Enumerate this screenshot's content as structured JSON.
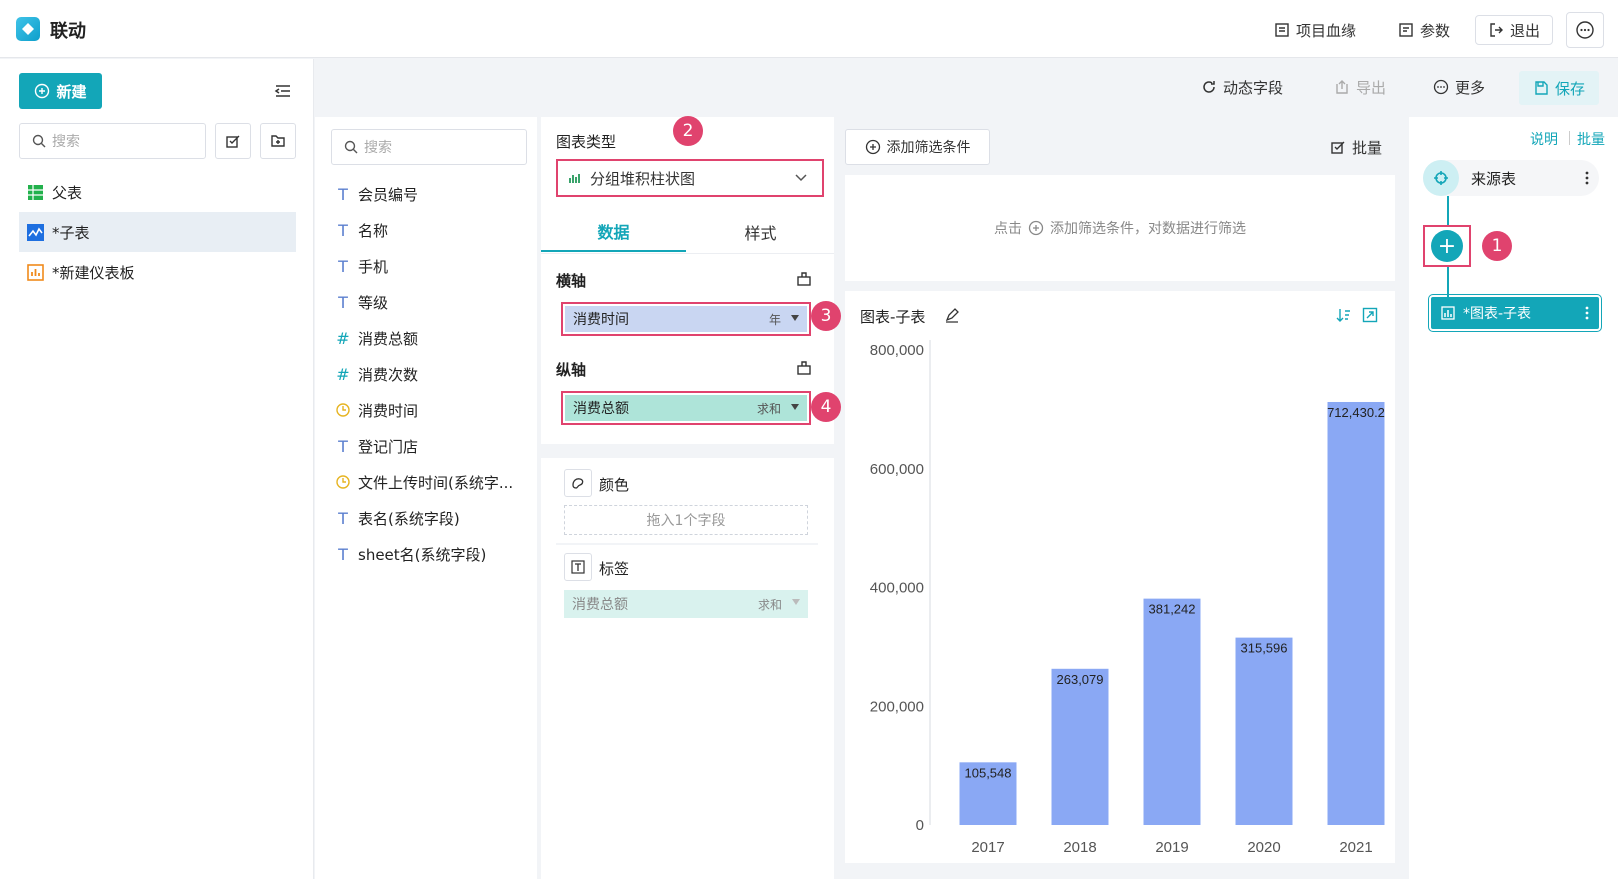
{
  "app": {
    "title": "联动"
  },
  "topbar": {
    "lineage": "项目血缘",
    "params": "参数",
    "exit": "退出"
  },
  "toolbar": {
    "dynamic_field": "动态字段",
    "export": "导出",
    "more": "更多",
    "save": "保存"
  },
  "sidebar": {
    "new_label": "新建",
    "search_placeholder": "搜索",
    "items": [
      {
        "label": "父表",
        "icon": "table-icon"
      },
      {
        "label": "*子表",
        "icon": "line-chart-icon"
      },
      {
        "label": "*新建仪表板",
        "icon": "dashboard-icon"
      }
    ]
  },
  "fields": {
    "search_placeholder": "搜索",
    "items": [
      {
        "label": "会员编号",
        "type": "T"
      },
      {
        "label": "名称",
        "type": "T"
      },
      {
        "label": "手机",
        "type": "T"
      },
      {
        "label": "等级",
        "type": "T"
      },
      {
        "label": "消费总额",
        "type": "#"
      },
      {
        "label": "消费次数",
        "type": "#"
      },
      {
        "label": "消费时间",
        "type": "time"
      },
      {
        "label": "登记门店",
        "type": "T"
      },
      {
        "label": "文件上传时间(系统字...",
        "type": "time"
      },
      {
        "label": "表名(系统字段)",
        "type": "T"
      },
      {
        "label": "sheet名(系统字段)",
        "type": "T"
      }
    ]
  },
  "config": {
    "chart_type_label": "图表类型",
    "chart_type_value": "分组堆积柱状图",
    "tab_data": "数据",
    "tab_style": "样式",
    "x_axis_label": "横轴",
    "x_field": "消费时间",
    "x_agg": "年",
    "y_axis_label": "纵轴",
    "y_field": "消费总额",
    "y_agg": "求和",
    "color_label": "颜色",
    "color_drop": "拖入1个字段",
    "tag_label": "标签",
    "tag_field": "消费总额",
    "tag_agg": "求和"
  },
  "badges": {
    "b1": "1",
    "b2": "2",
    "b3": "3",
    "b4": "4"
  },
  "filter": {
    "add_label": "添加筛选条件",
    "batch": "批量",
    "hint_click": "点击",
    "hint_rest": "添加筛选条件，对数据进行筛选"
  },
  "chart_title": "图表-子表",
  "right": {
    "explain": "说明",
    "batch": "批量",
    "source_node": "来源表",
    "chart_node": "*图表-子表"
  },
  "colors": {
    "accent": "#13a6b8",
    "bar": "#8aa8f4",
    "highlight": "#e0436e"
  },
  "chart_data": {
    "type": "bar",
    "categories": [
      "2017",
      "2018",
      "2019",
      "2020",
      "2021"
    ],
    "values": [
      105548,
      263079,
      381242,
      315596,
      712430.2
    ],
    "value_labels": [
      "105,548",
      "263,079",
      "381,242",
      "315,596",
      "712,430.2"
    ],
    "yticks": [
      "0",
      "200,000",
      "400,000",
      "600,000",
      "800,000"
    ],
    "ylim": [
      0,
      800000
    ],
    "grid": false
  }
}
